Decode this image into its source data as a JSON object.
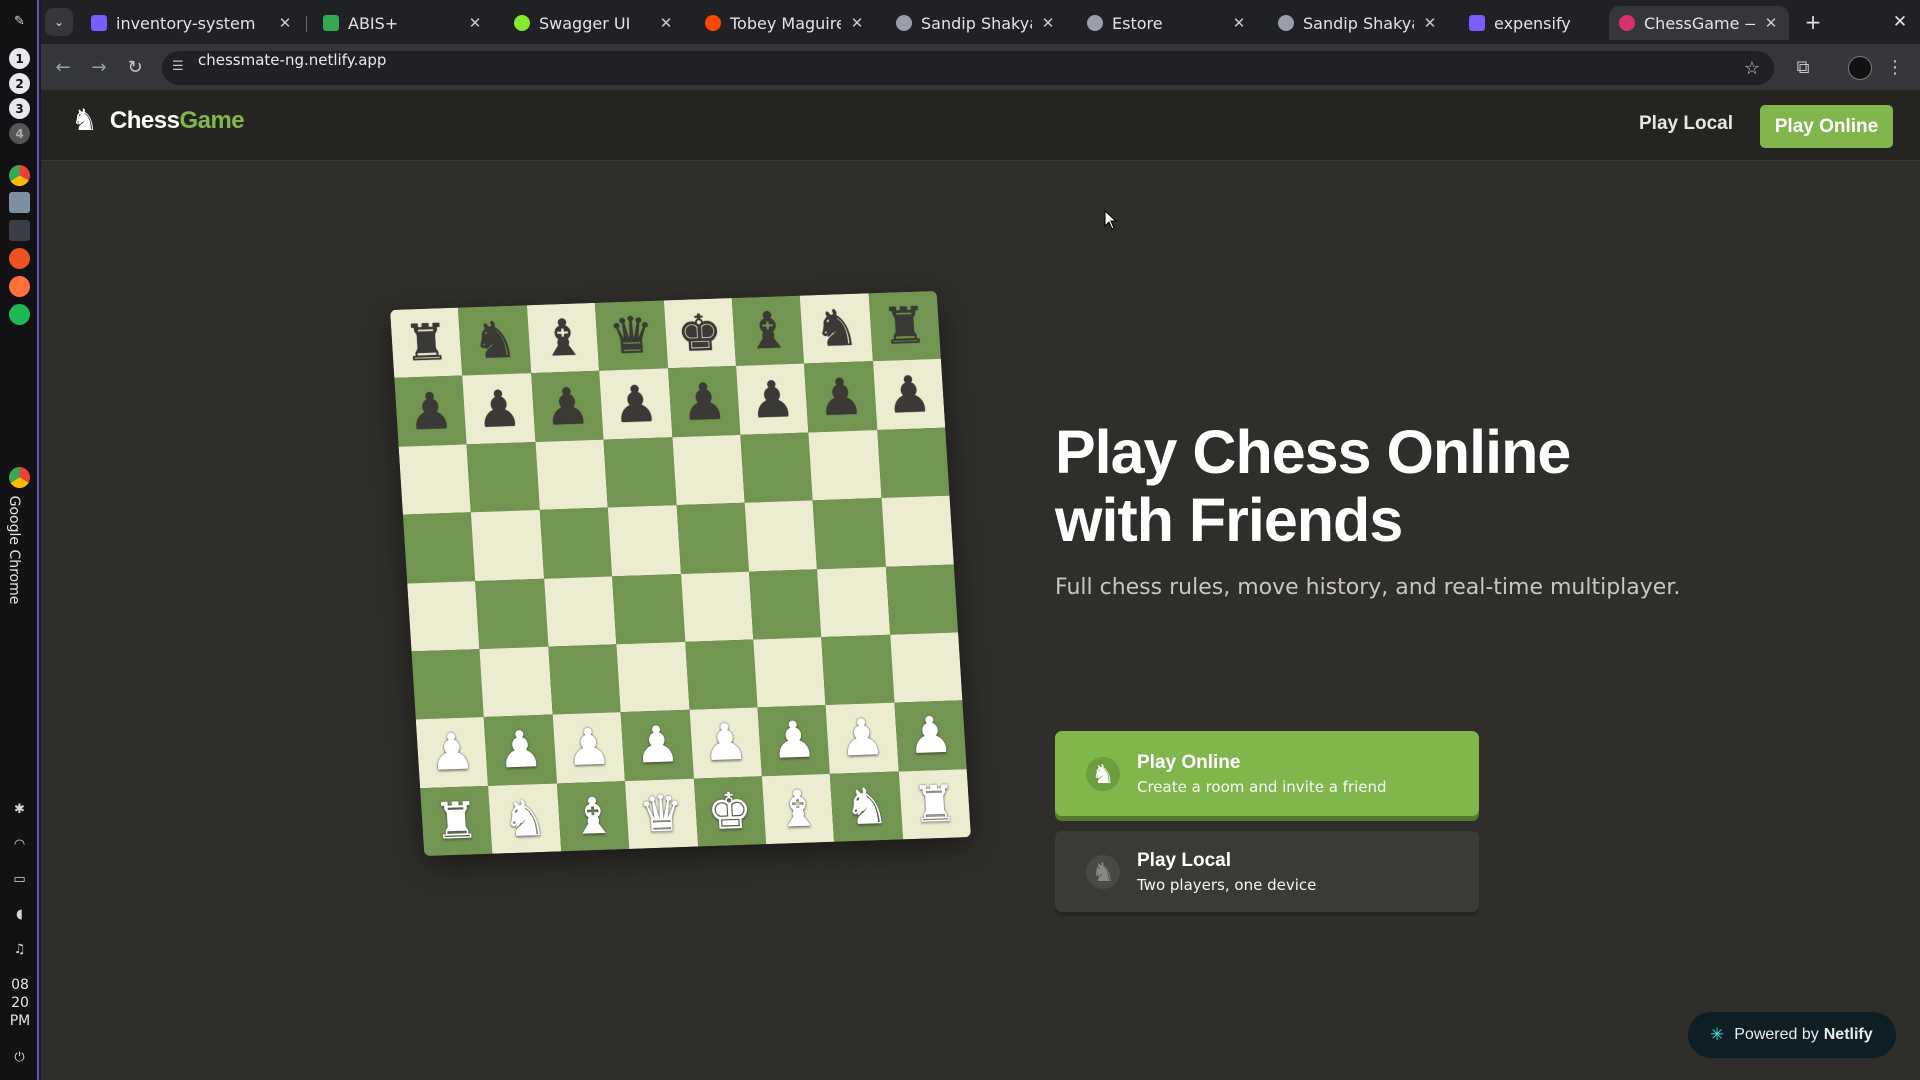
{
  "os": {
    "workspaces": [
      "1",
      "2",
      "3",
      "4"
    ],
    "vertical_app_label": "Google Chrome",
    "clock": {
      "hour": "08",
      "minute": "20",
      "meridiem": "PM"
    }
  },
  "browser": {
    "tabs": [
      {
        "title": "inventory-system",
        "favicon": "#7b5cff",
        "active": false
      },
      {
        "title": "ABIS+",
        "favicon": "#34a853",
        "active": false
      },
      {
        "title": "Swagger UI",
        "favicon": "#85ea2d",
        "active": false
      },
      {
        "title": "Tobey Maguire &",
        "favicon": "#ff4500",
        "active": false
      },
      {
        "title": "Sandip Shakya –",
        "favicon": "#9aa0a6",
        "active": false
      },
      {
        "title": "Estore",
        "favicon": "#9aa0a6",
        "active": false
      },
      {
        "title": "Sandip Shakya –",
        "favicon": "#9aa0a6",
        "active": false
      },
      {
        "title": "expensify",
        "favicon": "#7b5cff",
        "active": false
      },
      {
        "title": "ChessGame — Play",
        "favicon": "#d6336c",
        "active": true
      }
    ],
    "url": "chessmate-ng.netlify.app"
  },
  "site": {
    "brand_main": "Chess",
    "brand_accent": "Game",
    "nav_local": "Play Local",
    "nav_online": "Play Online"
  },
  "hero": {
    "title_line1": "Play Chess Online",
    "title_line2": "with Friends",
    "subtitle": "Full chess rules, move history, and real-time multiplayer."
  },
  "cta_online": {
    "title": "Play Online",
    "subtitle": "Create a room and invite a friend"
  },
  "cta_local": {
    "title": "Play Local",
    "subtitle": "Two players, one device"
  },
  "netlify": {
    "prefix": "Powered by",
    "brand": "Netlify"
  },
  "board": {
    "rows": [
      "rnbqkbnr",
      "pppppppp",
      "........",
      "........",
      "........",
      "........",
      "PPPPPPPP",
      "RNBQKBNR"
    ]
  },
  "colors": {
    "accent": "#81b64c",
    "light_square": "#ebecd0",
    "dark_square": "#739552",
    "page_bg": "#302e2b"
  }
}
